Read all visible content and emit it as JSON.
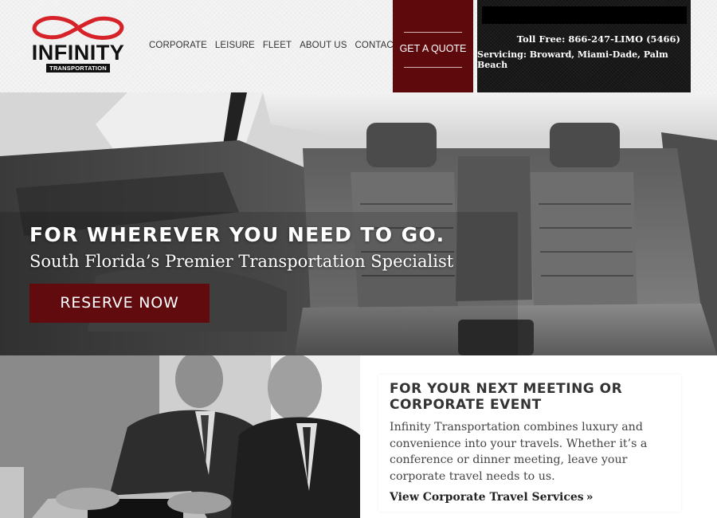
{
  "brand": {
    "name": "INFINITY",
    "subname": "TRANSPORTATION",
    "accent_red": "#d52329",
    "brand_maroon": "#620b0e"
  },
  "nav": {
    "items": [
      {
        "label": "CORPORATE"
      },
      {
        "label": "LEISURE"
      },
      {
        "label": "FLEET"
      },
      {
        "label": "ABOUT US"
      },
      {
        "label": "CONTACT US"
      }
    ]
  },
  "quote_button": {
    "label": "GET A QUOTE"
  },
  "contact": {
    "toll_free": "Toll Free: 866-247-LIMO (5466)",
    "servicing": "Servicing: Broward, Miami-Dade, Palm Beach"
  },
  "hero": {
    "title": "FOR WHEREVER YOU NEED TO GO.",
    "subtitle": "South Florida’s Premier Transportation Specialist",
    "cta": "RESERVE NOW"
  },
  "corporate": {
    "title": "FOR YOUR NEXT MEETING OR CORPORATE EVENT",
    "body": "Infinity Transportation combines luxury and convenience into your travels. Whether it’s a conference or dinner meeting, leave your corporate travel needs to us.",
    "link": "View Corporate Travel Services",
    "link_icon": "double-chevron-right-icon"
  }
}
